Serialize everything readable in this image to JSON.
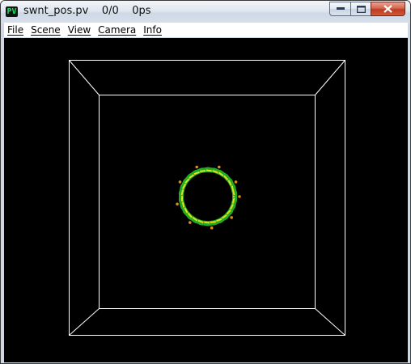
{
  "window": {
    "app_icon_text": "PV",
    "title": "swnt_pos.pv    0/0    0ps"
  },
  "menu": {
    "items": [
      {
        "label": "File"
      },
      {
        "label": "Scene"
      },
      {
        "label": "View"
      },
      {
        "label": "Camera"
      },
      {
        "label": "Info"
      }
    ]
  },
  "viewport": {
    "background": "#000000",
    "box_color": "#ffffff",
    "nanotube_colors": {
      "body": "#22aa22",
      "highlight": "#e0e020",
      "accent": "#e08a10"
    }
  }
}
